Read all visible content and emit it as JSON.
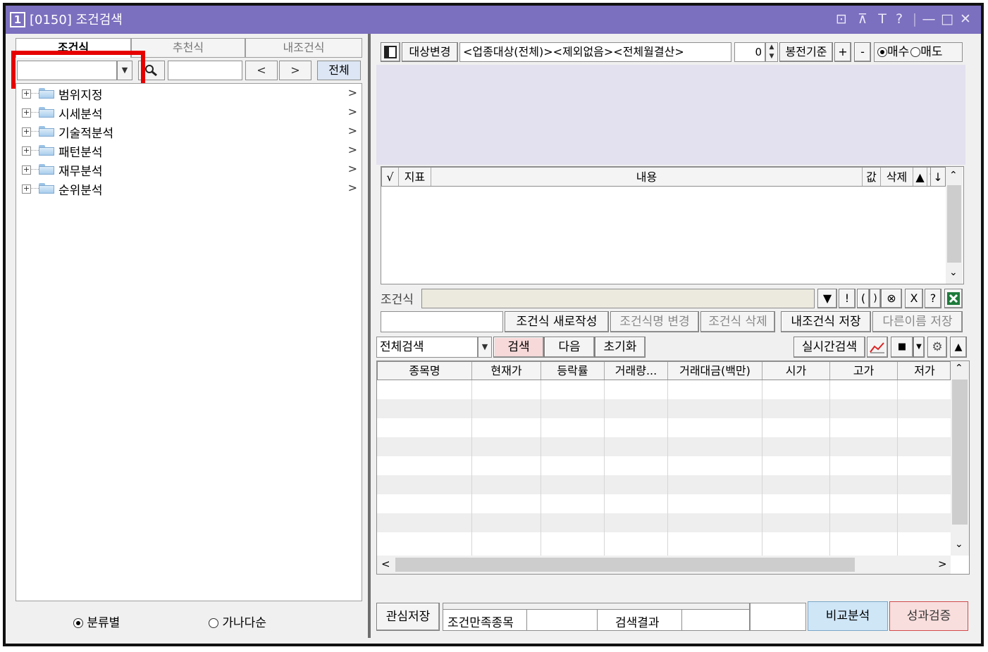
{
  "window": {
    "number": "1",
    "title": "[0150] 조건검색",
    "buttons": [
      "⊡",
      "⊼",
      "T",
      "?",
      "|",
      "—",
      "□",
      "✕"
    ]
  },
  "left": {
    "tabs": [
      "조건식",
      "추천식",
      "내조건식"
    ],
    "search": {
      "placeholder": "",
      "prev": "<",
      "next": ">",
      "all": "전체"
    },
    "tree": [
      "범위지정",
      "시세분석",
      "기술적분석",
      "패턴분석",
      "재무분석",
      "순위분석"
    ],
    "sort_options": [
      "분류별",
      "가나다순"
    ],
    "sort_selected": "분류별"
  },
  "right": {
    "target": {
      "change_button": "대상변경",
      "summary": "<업종대상(전체)><제외없음><전체월결산>",
      "count": "0",
      "basis": "봉전기준",
      "plus": "+",
      "minus": "-",
      "buy": "매수",
      "sell": "매도",
      "selected": "매수"
    },
    "indicator_grid": {
      "headers": [
        "√",
        "지표",
        "내용",
        "값",
        "삭제",
        "▲",
        "▼",
        "↑",
        "↓"
      ]
    },
    "condition": {
      "label": "조건식",
      "ops": [
        "▼",
        "!",
        "(",
        ")",
        "⊗",
        "X",
        "?"
      ]
    },
    "actions": {
      "new": "조건식 새로작성",
      "rename": "조건식명 변경",
      "delete": "조건식 삭제",
      "save_mine": "내조건식 저장",
      "save_as": "다른이름 저장"
    },
    "search_bar": {
      "scope": "전체검색",
      "search": "검색",
      "next": "다음",
      "reset": "초기화",
      "realtime": "실시간검색"
    },
    "result_grid": {
      "headers": [
        "종목명",
        "현재가",
        "등락률",
        "거래량...",
        "거래대금(백만)",
        "시가",
        "고가",
        "저가"
      ]
    },
    "bottom": {
      "watch_save": "관심저장",
      "matched": "조건만족종목",
      "result": "검색결과",
      "compare": "비교분석",
      "perf": "성과검증"
    }
  },
  "colors": {
    "titlebar": "#7b6fbf",
    "highlight": "#e60000",
    "search_btn": "#f7d9d9",
    "compare_btn": "#cfe6f7",
    "perf_btn": "#f9dede"
  }
}
